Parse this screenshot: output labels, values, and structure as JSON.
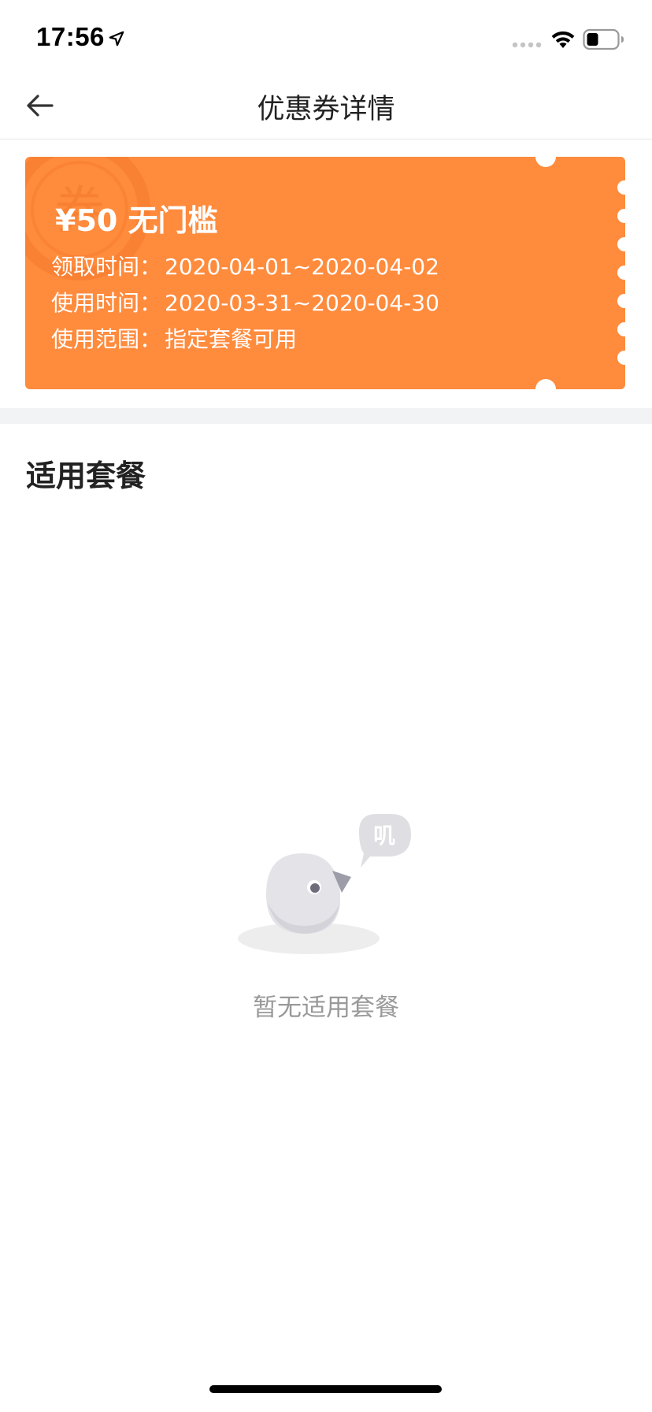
{
  "status_bar": {
    "time": "17:56",
    "icons": [
      "location-arrow-icon",
      "cellular-signal-icon",
      "wifi-icon",
      "battery-icon"
    ]
  },
  "nav": {
    "title": "优惠券详情",
    "back_icon": "arrow-left-icon"
  },
  "coupon": {
    "amount": "¥50 无门槛",
    "watermark_text": "券",
    "claim_label": "领取时间：",
    "claim_value": "2020-04-01~2020-04-02",
    "use_label": "使用时间：",
    "use_value": "2020-03-31~2020-04-30",
    "scope_label": "使用范围：",
    "scope_value": "指定套餐可用",
    "colors": {
      "background": "#ff8b3d",
      "text": "#ffffff"
    }
  },
  "section": {
    "title": "适用套餐"
  },
  "empty_state": {
    "bubble_text": "叽",
    "message": "暂无适用套餐",
    "illustration": "bird-mascot-icon"
  }
}
